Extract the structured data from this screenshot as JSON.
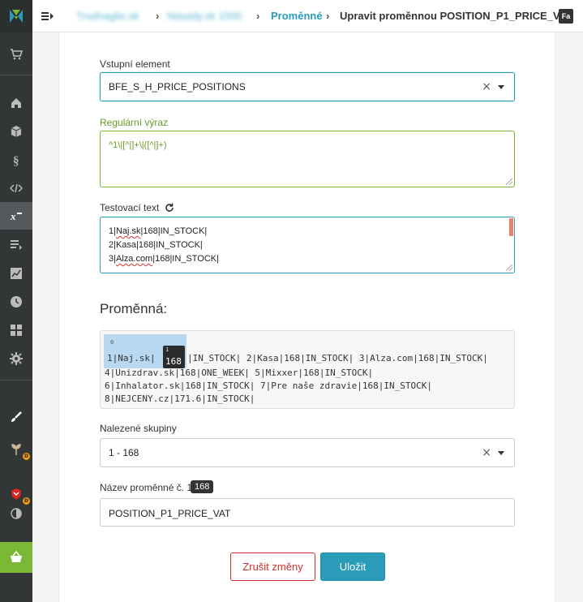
{
  "breadcrumb": {
    "item1": "Trudnaglio.sk",
    "item2": "Nasady.sk 1500",
    "item3": "Proměnné",
    "current": "Upravit proměnnou POSITION_P1_PRICE_VAT"
  },
  "user": {
    "initials": "Fa"
  },
  "form": {
    "input_element_label": "Vstupní element",
    "input_element_value": "BFE_S_H_PRICE_POSITIONS",
    "regex_label": "Regulární výraz",
    "regex_value": "^1\\|[^|]+\\|([^|]+)",
    "test_text_label": "Testovací text",
    "test_lines": [
      "1|",
      "Naj.sk",
      "|168|IN_STOCK|",
      "2|Kasa|168|IN_STOCK|",
      "3|",
      "Alza.com",
      "|168|IN_STOCK|"
    ],
    "variable_title": "Proměnná:",
    "match": {
      "group0_index": "0",
      "group0_prefix": "1|Naj.sk|",
      "group1_index": "1",
      "group1_value": "168",
      "line1_rest": "|IN_STOCK| 2|Kasa|168|IN_STOCK| 3|Alza.com|168|IN_STOCK|",
      "line2": "4|Unizdrav.sk|168|ONE_WEEK| 5|Mixxer|168|IN_STOCK|",
      "line3": "6|Inhalator.sk|168|IN_STOCK| 7|Pre naše zdravie|168|IN_STOCK|",
      "line4": "8|NEJCENY.cz|171.6|IN_STOCK|"
    },
    "groups_label": "Nalezené skupiny",
    "groups_value": "1 - 168",
    "var_name_label": "Název proměnné č. 1",
    "var_name_badge": "168",
    "var_name_value": "POSITION_P1_PRICE_VAT"
  },
  "buttons": {
    "cancel": "Zrušit změny",
    "save": "Uložit"
  },
  "colors": {
    "accent": "#2a9bb8",
    "sidebar": "#333637",
    "cancel": "#c9302c",
    "regex_green": "#7ab835"
  }
}
